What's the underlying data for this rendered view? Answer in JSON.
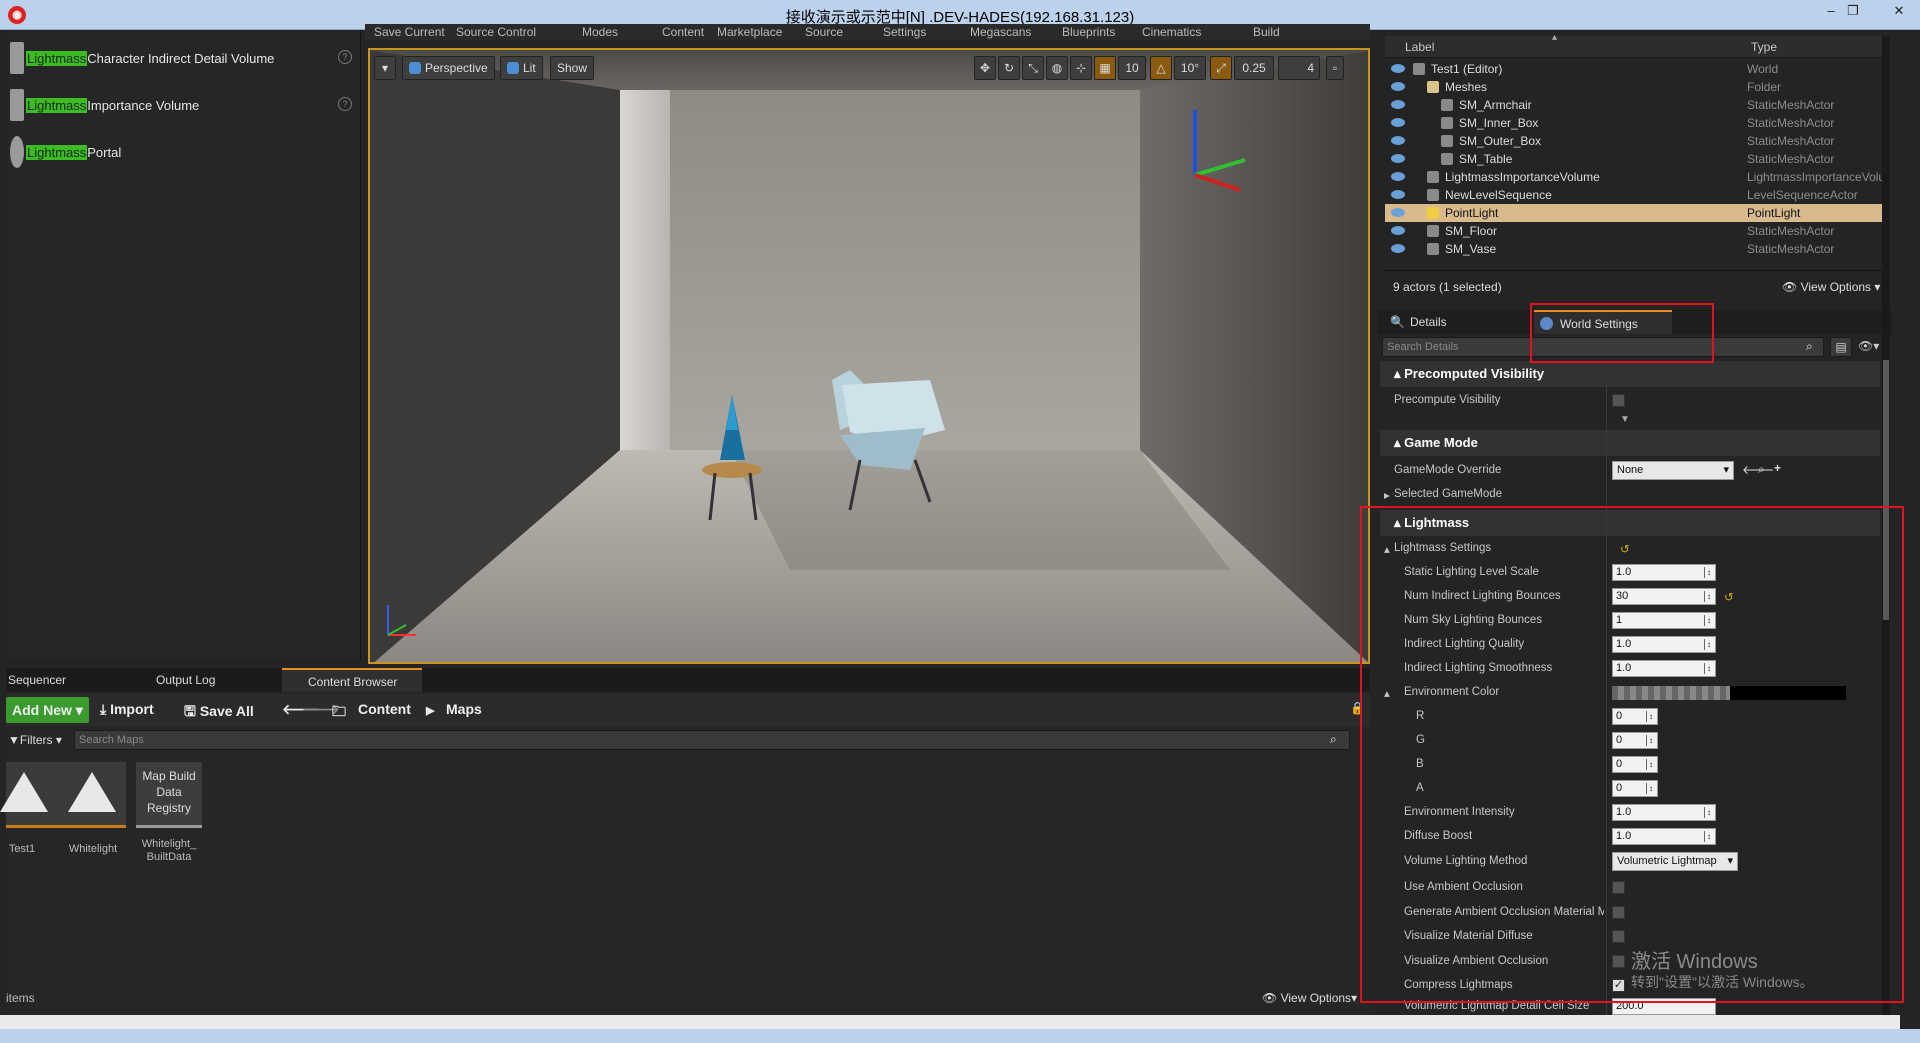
{
  "window": {
    "title": "接收演示或示范中[N] .DEV-HADES(192.168.31.123)",
    "buttons": [
      "–",
      "❐",
      "✕"
    ]
  },
  "main_toolbar": [
    "Save Current",
    "Source Control",
    "Modes",
    "Content",
    "Marketplace",
    "Source",
    "Settings",
    "Megascans",
    "Blueprints",
    "Cinematics",
    "Build"
  ],
  "modes_panel": {
    "items": [
      {
        "highlight": "Lightmass",
        "rest": "Character Indirect Detail Volume"
      },
      {
        "highlight": "Lightmass",
        "rest": "Importance Volume"
      },
      {
        "highlight": "Lightmass",
        "rest": "Portal"
      }
    ]
  },
  "viewport": {
    "perspective": "Perspective",
    "lit": "Lit",
    "show": "Show",
    "grid_snap": "10",
    "rot_snap": "10°",
    "scale_snap": "0.25",
    "cam_speed": "4"
  },
  "outliner": {
    "col_label": "Label",
    "col_type": "Type",
    "rows": [
      {
        "label": "Test1 (Editor)",
        "type": "World",
        "indent": 0,
        "icon": "world-icon"
      },
      {
        "label": "Meshes",
        "type": "Folder",
        "indent": 1,
        "icon": "folder-icon"
      },
      {
        "label": "SM_Armchair",
        "type": "StaticMeshActor",
        "indent": 2,
        "icon": "mesh-icon"
      },
      {
        "label": "SM_Inner_Box",
        "type": "StaticMeshActor",
        "indent": 2,
        "icon": "mesh-icon"
      },
      {
        "label": "SM_Outer_Box",
        "type": "StaticMeshActor",
        "indent": 2,
        "icon": "mesh-icon"
      },
      {
        "label": "SM_Table",
        "type": "StaticMeshActor",
        "indent": 2,
        "icon": "mesh-icon"
      },
      {
        "label": "LightmassImportanceVolume",
        "type": "LightmassImportanceVolu",
        "indent": 1,
        "icon": "volume-icon"
      },
      {
        "label": "NewLevelSequence",
        "type": "LevelSequenceActor",
        "indent": 1,
        "icon": "sequence-icon"
      },
      {
        "label": "PointLight",
        "type": "PointLight",
        "indent": 1,
        "icon": "light-icon",
        "selected": true
      },
      {
        "label": "SM_Floor",
        "type": "StaticMeshActor",
        "indent": 1,
        "icon": "mesh-icon"
      },
      {
        "label": "SM_Vase",
        "type": "StaticMeshActor",
        "indent": 1,
        "icon": "mesh-icon"
      }
    ],
    "status": "9 actors (1 selected)",
    "view_options": "View Options"
  },
  "details": {
    "tab_details": "Details",
    "tab_world": "World Settings",
    "search_placeholder": "Search Details",
    "sections": {
      "precomputed": "Precomputed Visibility",
      "game_mode": "Game Mode",
      "lightmass": "Lightmass"
    },
    "precompute_visibility": "Precompute Visibility",
    "gamemode_override": "GameMode Override",
    "gamemode_value": "None",
    "selected_gamemode": "Selected GameMode",
    "lightmass_settings": "Lightmass Settings",
    "props": [
      {
        "label": "Static Lighting Level Scale",
        "value": "1.0"
      },
      {
        "label": "Num Indirect Lighting Bounces",
        "value": "30"
      },
      {
        "label": "Num Sky Lighting Bounces",
        "value": "1"
      },
      {
        "label": "Indirect Lighting Quality",
        "value": "1.0"
      },
      {
        "label": "Indirect Lighting Smoothness",
        "value": "1.0"
      }
    ],
    "environment_color": "Environment Color",
    "rgba": [
      {
        "label": "R",
        "value": "0"
      },
      {
        "label": "G",
        "value": "0"
      },
      {
        "label": "B",
        "value": "0"
      },
      {
        "label": "A",
        "value": "0"
      }
    ],
    "environment_intensity": {
      "label": "Environment Intensity",
      "value": "1.0"
    },
    "diffuse_boost": {
      "label": "Diffuse Boost",
      "value": "1.0"
    },
    "volume_method": {
      "label": "Volume Lighting Method",
      "value": "Volumetric Lightmap"
    },
    "checks": [
      {
        "label": "Use Ambient Occlusion",
        "checked": false
      },
      {
        "label": "Generate Ambient Occlusion Material M",
        "checked": false
      },
      {
        "label": "Visualize Material Diffuse",
        "checked": false
      },
      {
        "label": "Visualize Ambient Occlusion",
        "checked": false
      },
      {
        "label": "Compress Lightmaps",
        "checked": true
      }
    ],
    "cell_size": {
      "label": "Volumetric Lightmap Detail Cell Size",
      "value": "200.0"
    }
  },
  "content_browser": {
    "tabs": [
      "Sequencer",
      "Output Log",
      "Content Browser"
    ],
    "add_new": "Add New",
    "import": "Import",
    "save_all": "Save All",
    "path": [
      "Content",
      "Maps"
    ],
    "filters": "Filters",
    "search_placeholder": "Search Maps",
    "assets": [
      {
        "label": "Test1"
      },
      {
        "label": "Whitelight"
      },
      {
        "label": "Whitelight_ BuiltData",
        "thumb": "Map Build Data Registry"
      }
    ],
    "items_count": "items",
    "view_options": "View Options"
  },
  "watermark": {
    "line1": "激活 Windows",
    "line2": "转到\"设置\"以激活 Windows。"
  },
  "colors": {
    "accent_selection": "#d8ba8c",
    "highlight_green": "#3dbb22",
    "annotation_red": "#e0141e",
    "viewport_border": "#c8961e"
  }
}
